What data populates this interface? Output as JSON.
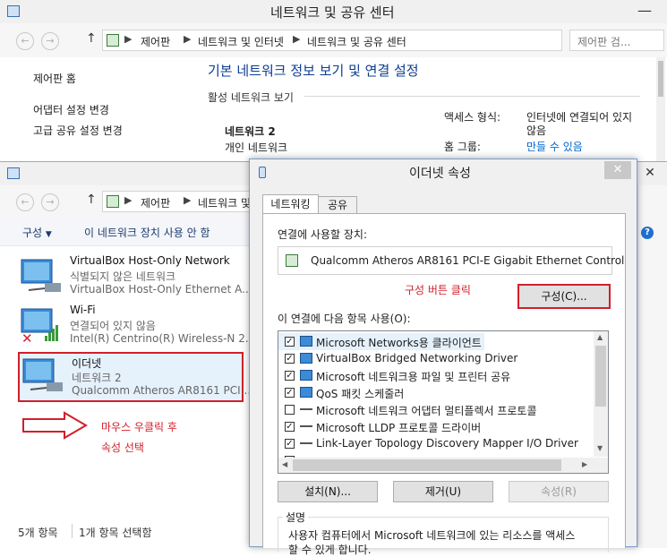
{
  "main_window": {
    "title": "네트워크 및 공유 센터",
    "breadcrumb": [
      "제어판",
      "네트워크 및 인터넷",
      "네트워크 및 공유 센터"
    ],
    "search_placeholder": "제어판 검...",
    "sidebar": [
      "제어판 홈",
      "어댑터 설정 변경",
      "고급 공유 설정 변경"
    ],
    "heading": "기본 네트워크 정보 보기 및 연결 설정",
    "active_networks": "활성 네트워크 보기",
    "network_name": "네트워크 2",
    "network_type": "개인 네트워크",
    "access_type_label": "액세스 형식:",
    "access_type_value_1": "인터넷에 연결되어 있지",
    "access_type_value_2": "않음",
    "homegroup_label": "홈 그룹:",
    "homegroup_value": "만들 수 있음"
  },
  "connections_window": {
    "breadcrumb": [
      "제어판",
      "네트워크 및 인"
    ],
    "toolbar_organize": "구성",
    "toolbar_disable": "이 네트워크 장치 사용 안 함",
    "items": [
      {
        "name": "VirtualBox Host-Only Network",
        "status": "식별되지 않은 네트워크",
        "adapter": "VirtualBox Host-Only Ethernet A..."
      },
      {
        "name": "Wi-Fi",
        "status": "연결되어 있지 않음",
        "adapter": "Intel(R) Centrino(R) Wireless-N 2..."
      },
      {
        "name": "이더넷",
        "status": "네트워크 2",
        "adapter": "Qualcomm Atheros AR8161 PCI..."
      }
    ],
    "annotation_1": "마우스 우클릭 후",
    "annotation_2": "속성 선택",
    "status_count": "5개 항목",
    "status_selected": "1개 항목 선택함"
  },
  "dialog": {
    "title": "이더넷 속성",
    "tabs": [
      "네트워킹",
      "공유"
    ],
    "connect_using_label": "연결에 사용할 장치:",
    "adapter_name": "Qualcomm Atheros AR8161 PCI-E Gigabit Ethernet Control",
    "annotation": "구성 버튼 클릭",
    "configure_button": "구성(C)...",
    "items_label": "이 연결에 다음 항목 사용(O):",
    "items": [
      {
        "label": "Microsoft Networks용 클라이언트",
        "checked": true
      },
      {
        "label": "VirtualBox Bridged Networking Driver",
        "checked": true
      },
      {
        "label": "Microsoft 네트워크용 파일 및 프린터 공유",
        "checked": true
      },
      {
        "label": "QoS 패킷 스케줄러",
        "checked": true
      },
      {
        "label": "Microsoft 네트워크 어댑터 멀티플렉서 프로토콜",
        "checked": false
      },
      {
        "label": "Microsoft LLDP 프로토콜 드라이버",
        "checked": true
      },
      {
        "label": "Link-Layer Topology Discovery Mapper I/O Driver",
        "checked": true
      }
    ],
    "install_button": "설치(N)...",
    "uninstall_button": "제거(U)",
    "properties_button": "속성(R)",
    "description_label": "설명",
    "description_1": "사용자 컴퓨터에서 Microsoft 네트워크에 있는 리소스를 액세스",
    "description_2": "할 수 있게 합니다."
  },
  "colors": {
    "annotation_red": "#d21f2a",
    "heading_blue": "#0b3d91",
    "link_blue": "#0066cc",
    "chrome": "#f0f0f0"
  }
}
